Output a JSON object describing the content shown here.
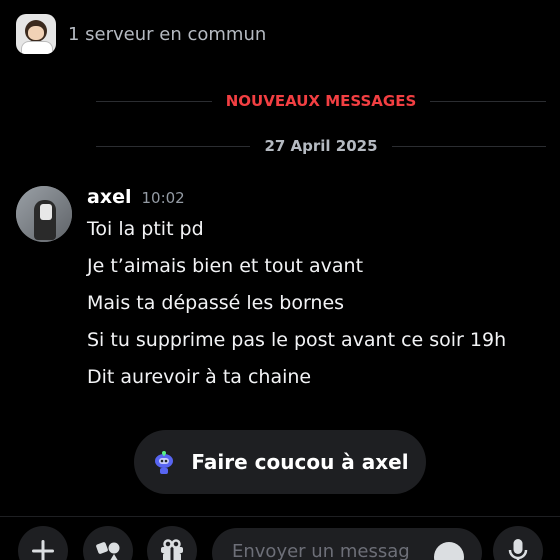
{
  "header": {
    "common_servers": "1 serveur en commun"
  },
  "dividers": {
    "new_messages": "NOUVEAUX MESSAGES",
    "date": "27 April 2025"
  },
  "message": {
    "author": "axel",
    "time": "10:02",
    "lines": [
      "Toi la ptit pd",
      "Je t’aimais bien et tout avant",
      "Mais ta dépassé les bornes",
      "Si tu supprime pas le post avant ce soir 19h",
      "Dit aurevoir à ta chaine"
    ]
  },
  "wave_button": {
    "label": "Faire coucou à axel",
    "icon": "wave-bot-icon"
  },
  "composer": {
    "placeholder": "Envoyer un messag"
  },
  "icons": {
    "plus": "plus-icon",
    "apps": "apps-icon",
    "gift": "gift-icon",
    "emoji": "emoji-icon",
    "mic": "microphone-icon"
  },
  "colors": {
    "background": "#000000",
    "new_messages_accent": "#f23f42",
    "muted_text": "#b5bac1",
    "surface": "#1e1f22"
  }
}
